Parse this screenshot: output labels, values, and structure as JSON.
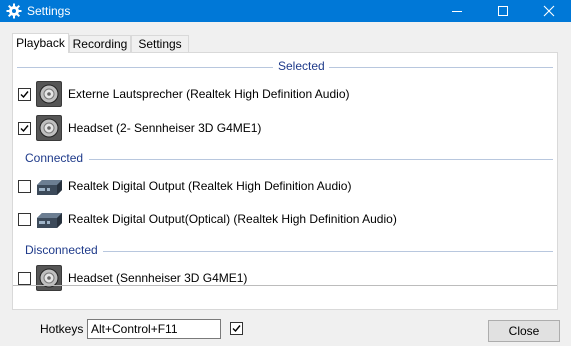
{
  "window": {
    "title": "Settings",
    "title_icon": "gear-icon",
    "controls": [
      "minimize-icon",
      "maximize-icon",
      "close-icon"
    ],
    "accent_color": "#0078d7"
  },
  "tabs": [
    {
      "label": "Playback",
      "active": true
    },
    {
      "label": "Recording",
      "active": false
    },
    {
      "label": "Settings",
      "active": false
    }
  ],
  "groups": {
    "selected": {
      "label": "Selected",
      "items": [
        {
          "label": "Externe Lautsprecher (Realtek High Definition Audio)",
          "checked": true,
          "icon": "speaker-icon"
        },
        {
          "label": "Headset (2- Sennheiser 3D G4ME1)",
          "checked": true,
          "icon": "speaker-icon"
        }
      ]
    },
    "connected": {
      "label": "Connected",
      "items": [
        {
          "label": "Realtek Digital Output (Realtek High Definition Audio)",
          "checked": false,
          "icon": "digital-output-icon"
        },
        {
          "label": "Realtek Digital Output(Optical) (Realtek High Definition Audio)",
          "checked": false,
          "icon": "digital-output-icon"
        }
      ]
    },
    "disconnected": {
      "label": "Disconnected",
      "items": [
        {
          "label": "Headset (Sennheiser 3D G4ME1)",
          "checked": false,
          "icon": "speaker-icon"
        }
      ]
    }
  },
  "footer": {
    "hotkeys_label": "Hotkeys",
    "hotkey_value": "Alt+Control+F11",
    "hotkey_enabled": true,
    "close_label": "Close"
  }
}
